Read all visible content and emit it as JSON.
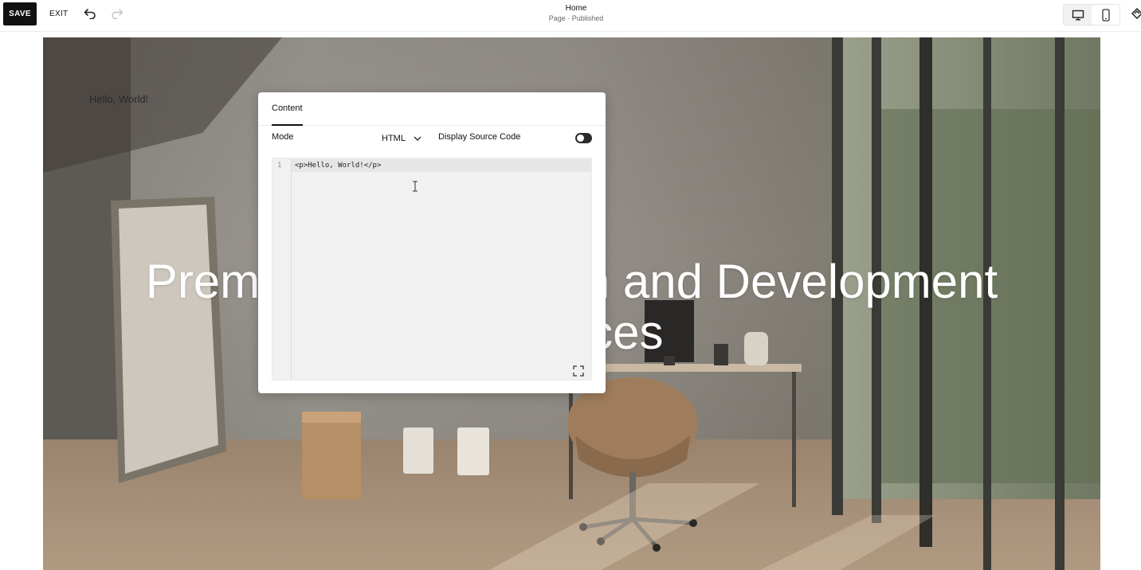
{
  "toolbar": {
    "save_label": "SAVE",
    "exit_label": "EXIT",
    "icons": [
      "undo-icon",
      "redo-icon",
      "desktop-icon",
      "mobile-icon",
      "style-icon"
    ]
  },
  "page_status": {
    "title": "Home",
    "subtitle": "Page · Published"
  },
  "canvas": {
    "hello_text": "Hello, World!",
    "heading_line1": "Premium Web Design and Development",
    "heading_line2": "Services"
  },
  "panel": {
    "tab_label": "Content",
    "mode_label": "Mode",
    "mode_value": "HTML",
    "source_label": "Display Source Code",
    "source_toggle": "on",
    "line_number": "1",
    "code_line": "<p>Hello, World!</p>"
  },
  "colors": {
    "save_bg": "#111111",
    "panel_bg": "#ffffff",
    "code_bg": "#f1f1f1",
    "heading": "#ffffff"
  }
}
